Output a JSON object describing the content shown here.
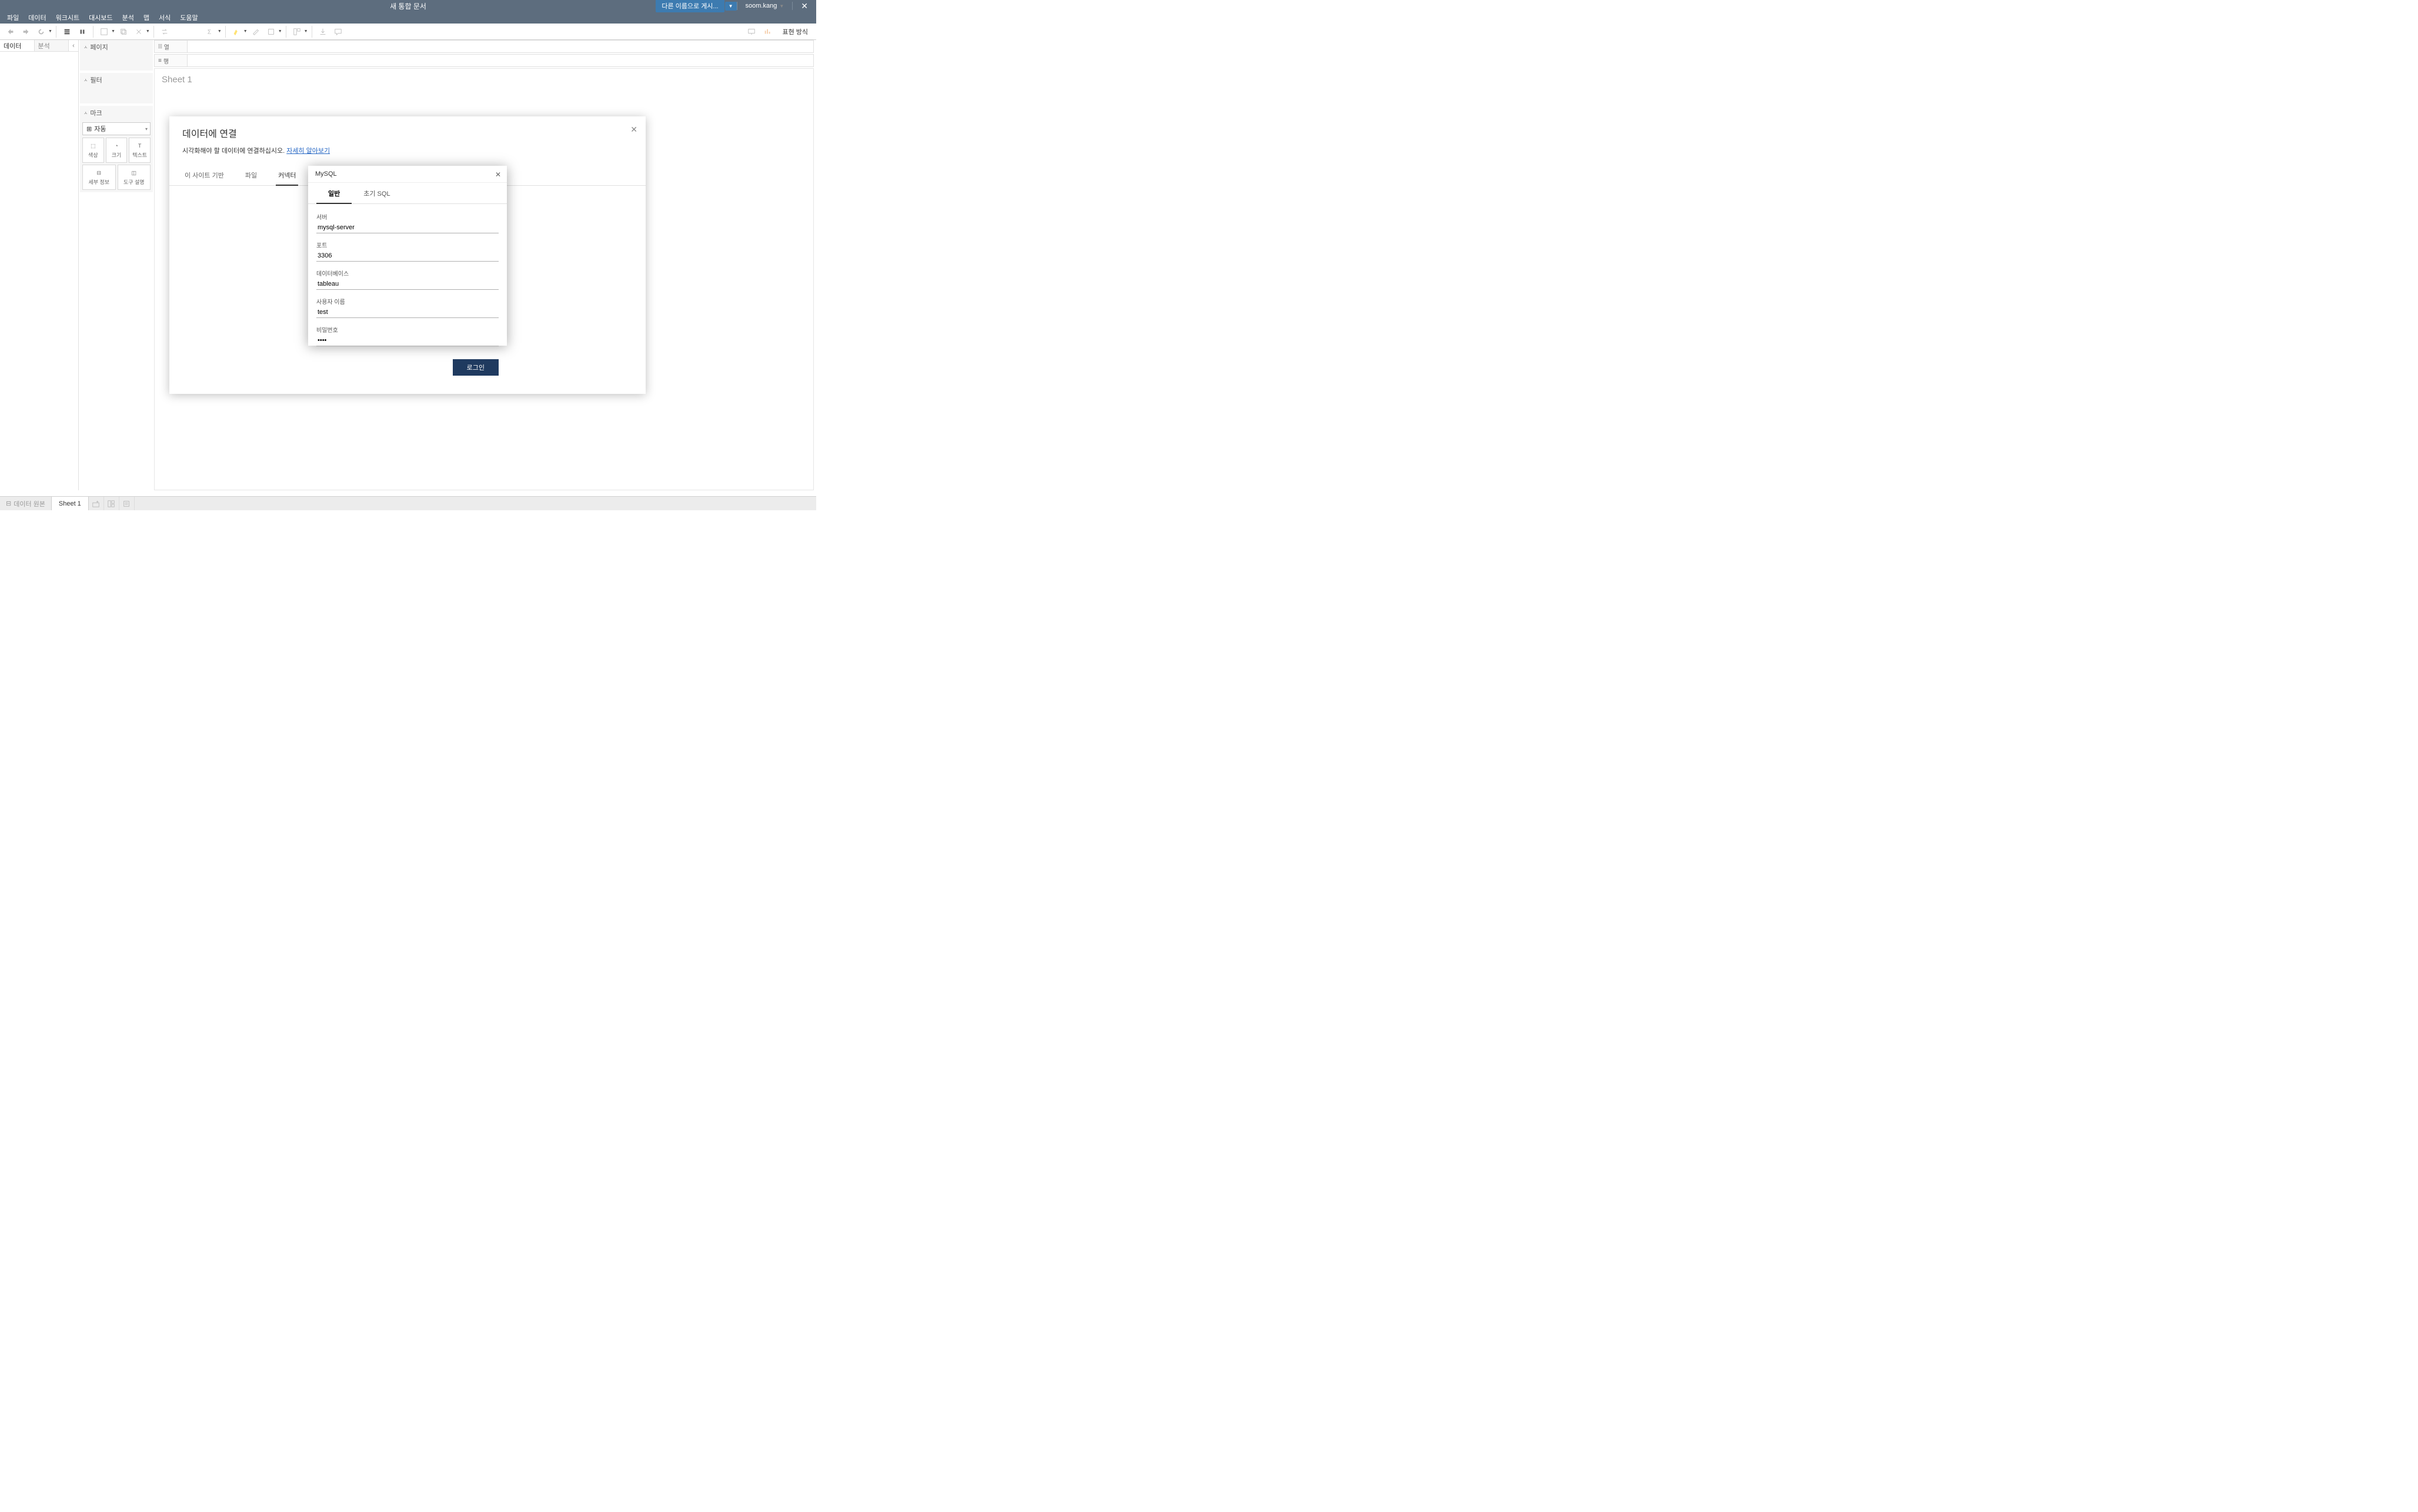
{
  "header": {
    "title": "새 통합 문서",
    "publish_label": "다른 이름으로 게시...",
    "user": "soom.kang"
  },
  "menu": {
    "file": "파일",
    "data": "데이터",
    "worksheet": "워크시트",
    "dashboard": "대시보드",
    "analysis": "분석",
    "map": "맵",
    "format": "서식",
    "help": "도움말"
  },
  "toolbar": {
    "present_label": "표현 방식"
  },
  "sidebar": {
    "data_tab": "데이터",
    "analytics_tab": "분석"
  },
  "cards": {
    "pages": "페이지",
    "filters": "필터",
    "marks": "마크",
    "mark_type": "자동",
    "color": "색상",
    "size": "크기",
    "text": "텍스트",
    "detail": "세부 정보",
    "tooltip": "도구 설명"
  },
  "shelves": {
    "columns": "열",
    "rows": "행"
  },
  "canvas": {
    "sheet_title": "Sheet 1"
  },
  "connect_dialog": {
    "title": "데이터에 연결",
    "subtitle_prefix": "시각화해야 할 데이터에 연결하십시오. ",
    "learn_more": "자세히 알아보기",
    "tabs": {
      "onsite": "이 사이트 기반",
      "file": "파일",
      "connector": "커넥터"
    }
  },
  "mysql": {
    "title": "MySQL",
    "tabs": {
      "general": "일반",
      "initial_sql": "초기 SQL"
    },
    "fields": {
      "server_label": "서버",
      "server_value": "mysql-server",
      "port_label": "포트",
      "port_value": "3306",
      "db_label": "데이터베이스",
      "db_value": "tableau",
      "user_label": "사용자 이름",
      "user_value": "test",
      "pwd_label": "비밀번호",
      "pwd_value": "••••"
    },
    "login": "로그인"
  },
  "bottom": {
    "datasource": "데이터 원본",
    "sheet1": "Sheet 1"
  }
}
